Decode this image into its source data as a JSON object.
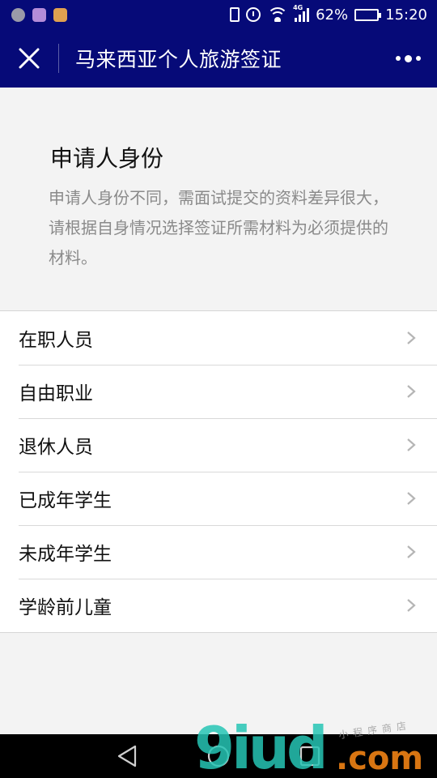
{
  "status_bar": {
    "network_label": "4G",
    "battery": "62%",
    "battery_level": 0.62,
    "time": "15:20"
  },
  "nav": {
    "title": "马来西亚个人旅游签证"
  },
  "intro": {
    "title": "申请人身份",
    "description": "申请人身份不同，需面试提交的资料差异很大，请根据自身情况选择签证所需材料为必须提供的材料。"
  },
  "list": {
    "items": [
      {
        "label": "在职人员"
      },
      {
        "label": "自由职业"
      },
      {
        "label": "退休人员"
      },
      {
        "label": "已成年学生"
      },
      {
        "label": "未成年学生"
      },
      {
        "label": "学龄前儿童"
      }
    ]
  },
  "watermark": {
    "logo": "9iud",
    "domain": ".com",
    "small": "小程序商店"
  },
  "colors": {
    "header_bg": "#060a78",
    "page_bg": "#f3f3f3",
    "description_text": "#8a8a8a"
  }
}
